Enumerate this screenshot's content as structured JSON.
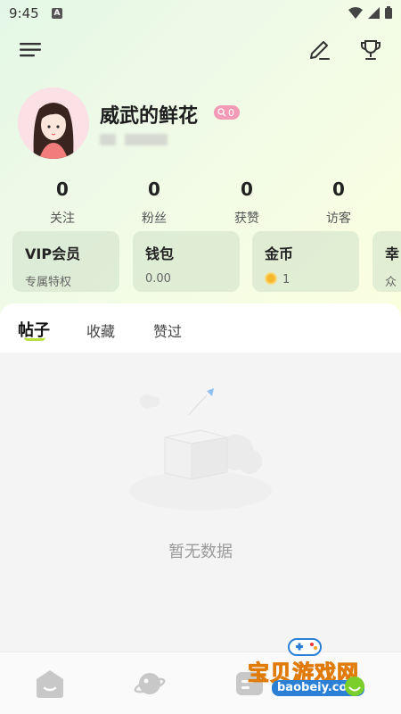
{
  "status_bar": {
    "time": "9:45",
    "notification_letter": "A"
  },
  "toolbar": {
    "menu_icon": "menu-icon",
    "edit_icon": "pencil-icon",
    "trophy_icon": "trophy-icon"
  },
  "profile": {
    "username": "威武的鲜花",
    "level": "0"
  },
  "stats": [
    {
      "value": "0",
      "label": "关注"
    },
    {
      "value": "0",
      "label": "粉丝"
    },
    {
      "value": "0",
      "label": "获赞"
    },
    {
      "value": "0",
      "label": "访客"
    }
  ],
  "cards": [
    {
      "title": "VIP会员",
      "subtitle": "专属特权"
    },
    {
      "title": "钱包",
      "subtitle": "0.00"
    },
    {
      "title": "金币",
      "subtitle": "1"
    },
    {
      "title": "幸",
      "subtitle": "众"
    }
  ],
  "tabs": [
    {
      "label": "帖子",
      "active": true
    },
    {
      "label": "收藏",
      "active": false
    },
    {
      "label": "赞过",
      "active": false
    }
  ],
  "empty_state": {
    "text": "暂无数据"
  },
  "bottom_nav": [
    {
      "icon": "home-icon"
    },
    {
      "icon": "planet-icon"
    },
    {
      "icon": "message-icon"
    }
  ],
  "watermark": {
    "cn": "宝贝游戏网",
    "url": "baobeiy.com"
  },
  "colors": {
    "accent_green": "#b9e03c",
    "level_pink": "#f29ab6",
    "coin_gold": "#f5b82e"
  }
}
